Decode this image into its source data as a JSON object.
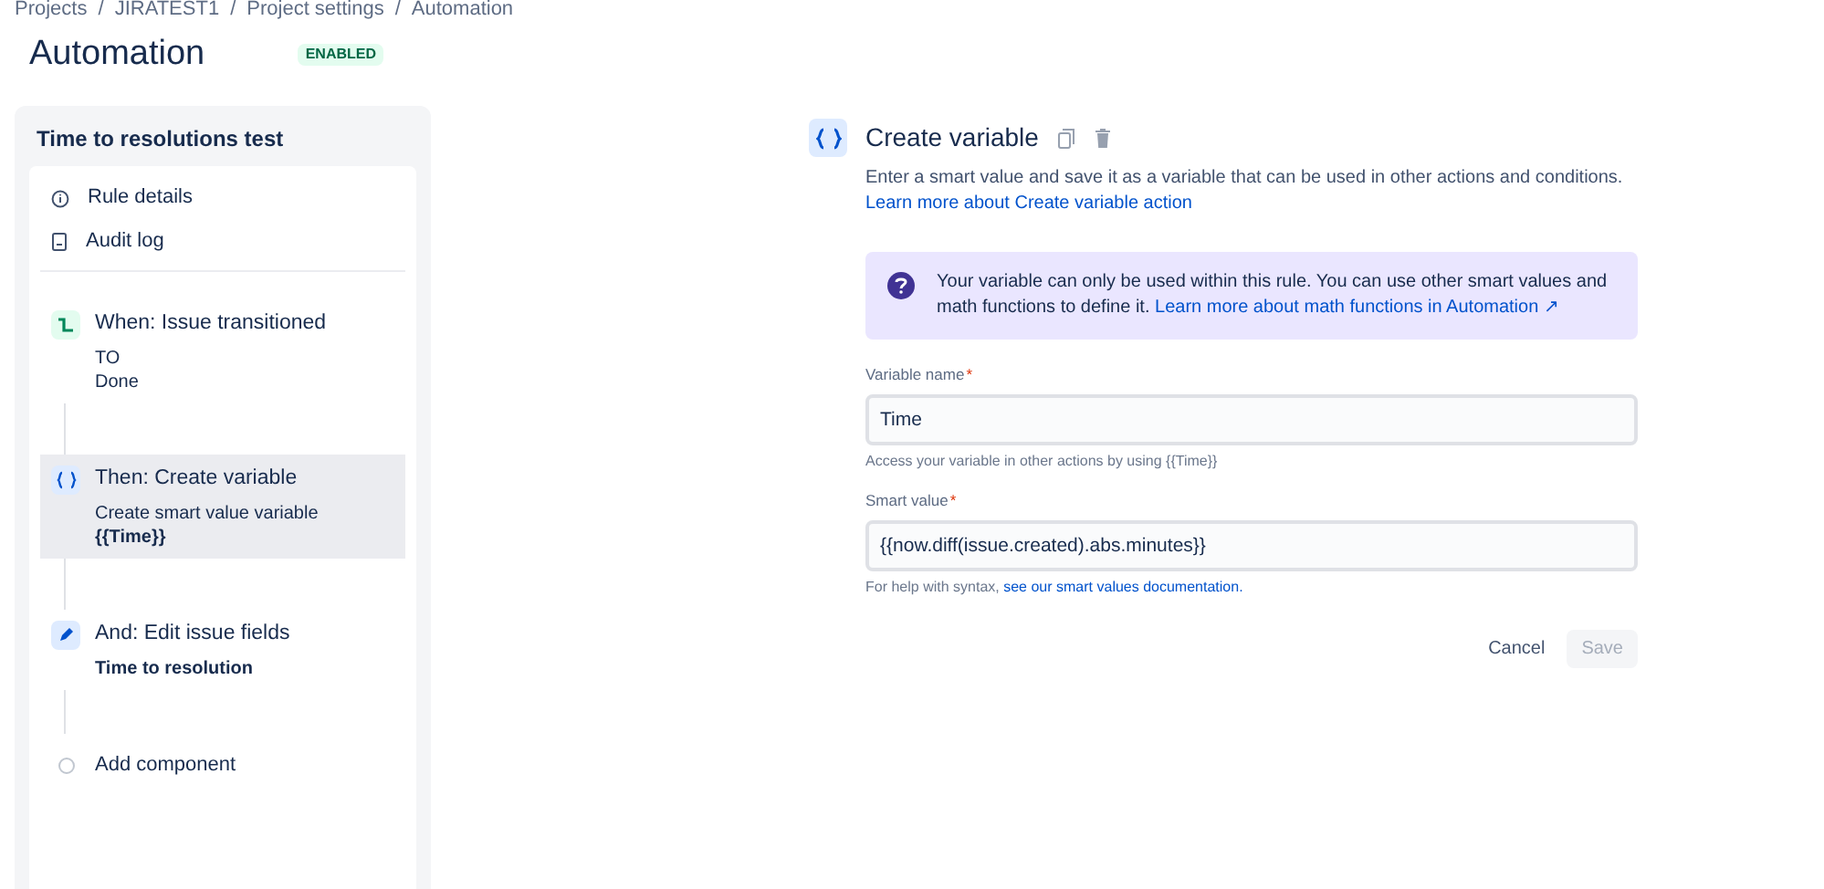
{
  "breadcrumbs": {
    "separator": "/",
    "items": [
      "Projects",
      "JIRATEST1",
      "Project settings",
      "Automation"
    ]
  },
  "header": {
    "title": "Automation",
    "status": "ENABLED"
  },
  "rule": {
    "title": "Time to resolutions test",
    "menu": [
      {
        "kind": "info",
        "label": "Rule details"
      },
      {
        "kind": "log",
        "label": "Audit log"
      }
    ],
    "steps": [
      {
        "kind": "trigger",
        "title": "When: Issue transitioned",
        "selected": false,
        "lines": [
          {
            "text": "TO",
            "strong": false
          },
          {
            "text": "Done",
            "strong": false
          }
        ]
      },
      {
        "kind": "variable",
        "title": "Then: Create variable",
        "selected": true,
        "lines": [
          {
            "text": "Create smart value variable",
            "strong": false
          },
          {
            "text": "{{Time}}",
            "strong": true
          }
        ]
      },
      {
        "kind": "edit",
        "title": "And: Edit issue fields",
        "selected": false,
        "lines": [
          {
            "text": "Time to resolution",
            "strong": true
          }
        ]
      }
    ],
    "add_component": "Add component"
  },
  "editor": {
    "title": "Create variable",
    "description": "Enter a smart value and save it as a variable that can be used in other actions and conditions.",
    "description_link": "Learn more about Create variable action",
    "notice": {
      "text": "Your variable can only be used within this rule. You can use other smart values and math functions to define it.",
      "link": "Learn more about math functions in Automation ↗"
    },
    "fields": [
      {
        "label": "Variable name",
        "required_mark": "*",
        "value": "Time",
        "help": "Access your variable in other actions by using {{Time}}"
      },
      {
        "label": "Smart value",
        "required_mark": "*",
        "value": "{{now.diff(issue.created).abs.minutes}}",
        "help": "For help with syntax,",
        "help_link": "see our smart values documentation."
      }
    ],
    "buttons": [
      {
        "label": "Cancel",
        "kind": "link",
        "disabled": false
      },
      {
        "label": "Save",
        "kind": "primary",
        "disabled": true
      }
    ]
  }
}
